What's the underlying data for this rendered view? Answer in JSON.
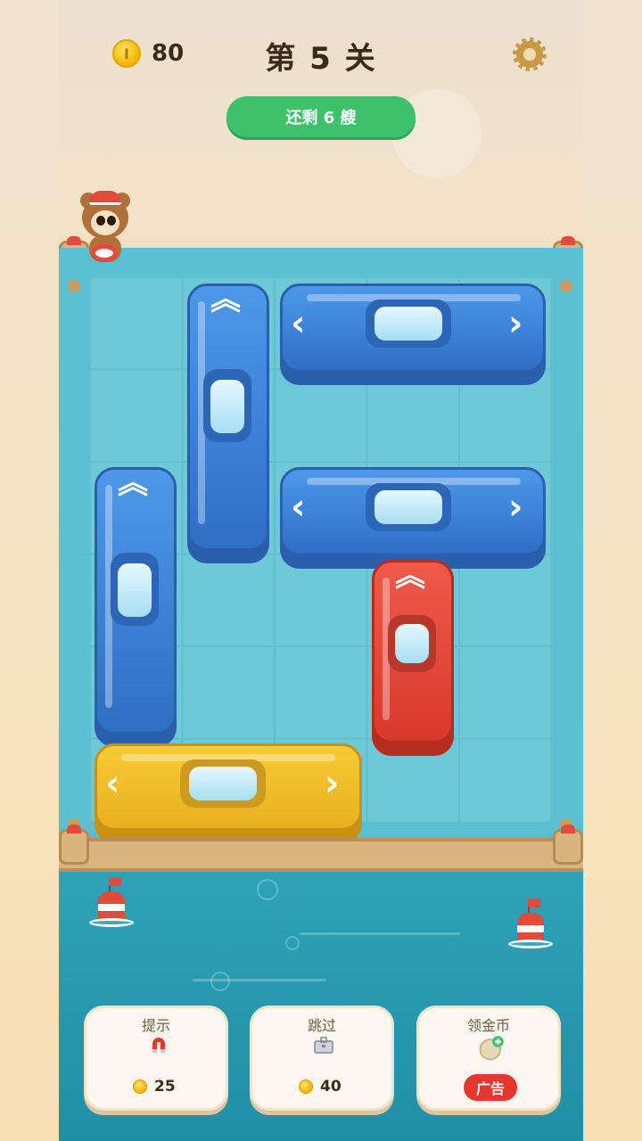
{
  "header": {
    "coins": "80",
    "coin_icon_letter": "I",
    "level_title": "第 5 关",
    "settings_icon": "gear-icon"
  },
  "status": {
    "remaining_label": "还剩 6 艘"
  },
  "board": {
    "grid": "5x6",
    "boats": [
      {
        "id": "blue-vertical-1",
        "color": "#3a7fd6",
        "orientation": "vertical",
        "arrow_icon": "double-chevron-up-icon"
      },
      {
        "id": "blue-horizontal-1",
        "color": "#3a7fd6",
        "orientation": "horizontal",
        "arrow_icons": [
          "chevron-left-icon",
          "chevron-right-icon"
        ]
      },
      {
        "id": "blue-vertical-2",
        "color": "#3a7fd6",
        "orientation": "vertical",
        "arrow_icon": "double-chevron-up-icon"
      },
      {
        "id": "blue-horizontal-2",
        "color": "#3a7fd6",
        "orientation": "horizontal",
        "arrow_icons": [
          "chevron-left-icon",
          "chevron-right-icon"
        ]
      },
      {
        "id": "red-vertical",
        "color": "#d8392c",
        "orientation": "vertical",
        "arrow_icon": "double-chevron-up-icon"
      },
      {
        "id": "yellow-horizontal",
        "color": "#e8b01f",
        "orientation": "horizontal",
        "arrow_icons": [
          "chevron-left-icon",
          "chevron-right-icon"
        ]
      }
    ]
  },
  "actions": {
    "hint": {
      "label": "提示",
      "icon": "magnet-icon",
      "cost": "25"
    },
    "skip": {
      "label": "跳过",
      "icon": "toolbox-icon",
      "cost": "40"
    },
    "get_coins": {
      "label": "领金币",
      "icon": "coin-plus-icon",
      "badge": "广告"
    }
  },
  "colors": {
    "accent_green": "#3dc26b",
    "water": "#2ea3b7",
    "ad_red": "#e5372c"
  }
}
